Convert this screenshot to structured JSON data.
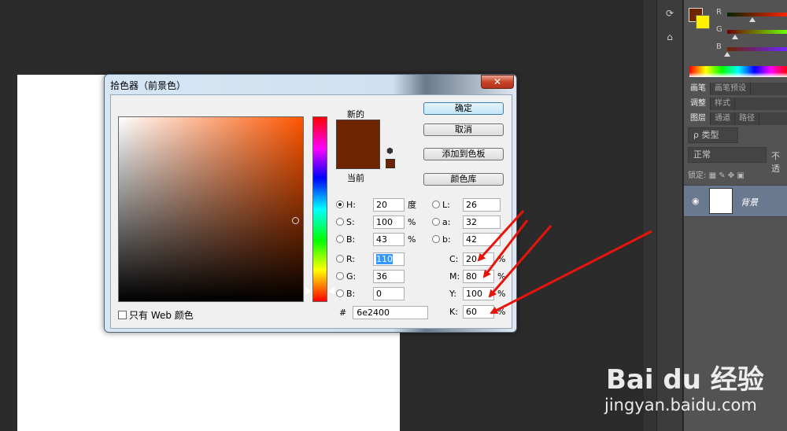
{
  "dialog": {
    "title": "拾色器（前景色）",
    "close_label": "✕",
    "new_label": "新的",
    "current_label": "当前",
    "buttons": {
      "ok": "确定",
      "cancel": "取消",
      "add_swatch": "添加到色板",
      "color_library": "颜色库"
    },
    "web_only_label": "只有 Web 颜色",
    "hex_label": "#",
    "hex_value": "6e2400",
    "fields": {
      "H": {
        "label": "H:",
        "value": "20",
        "unit": "度",
        "selected": true
      },
      "S": {
        "label": "S:",
        "value": "100",
        "unit": "%"
      },
      "Bv": {
        "label": "B:",
        "value": "43",
        "unit": "%"
      },
      "R": {
        "label": "R:",
        "value": "110"
      },
      "G": {
        "label": "G:",
        "value": "36"
      },
      "B": {
        "label": "B:",
        "value": "0"
      },
      "L": {
        "label": "L:",
        "value": "26"
      },
      "a": {
        "label": "a:",
        "value": "32"
      },
      "b": {
        "label": "b:",
        "value": "42"
      },
      "C": {
        "label": "C:",
        "value": "20",
        "unit": "%"
      },
      "M": {
        "label": "M:",
        "value": "80",
        "unit": "%"
      },
      "Y": {
        "label": "Y:",
        "value": "100",
        "unit": "%"
      },
      "K": {
        "label": "K:",
        "value": "60",
        "unit": "%"
      }
    },
    "colors": {
      "picked": "#6e2400"
    }
  },
  "right_panel": {
    "color_sliders": {
      "r": "R",
      "g": "G",
      "b": "B"
    },
    "tabs_row1": [
      "画笔",
      "画笔预设"
    ],
    "tabs_row2": [
      "调整",
      "样式"
    ],
    "tabs_row3": [
      "图层",
      "通道",
      "路径"
    ],
    "kind_filter": "ρ 类型",
    "blend_mode": "正常",
    "opacity_label_partial": "不透",
    "lock_label": "锁定:",
    "layer_name": "背景",
    "colors": {
      "foreground": "#6e2400",
      "background": "#fff000"
    }
  },
  "watermark": {
    "brand": "Bai du 经验",
    "url": "jingyan.baidu.com"
  }
}
